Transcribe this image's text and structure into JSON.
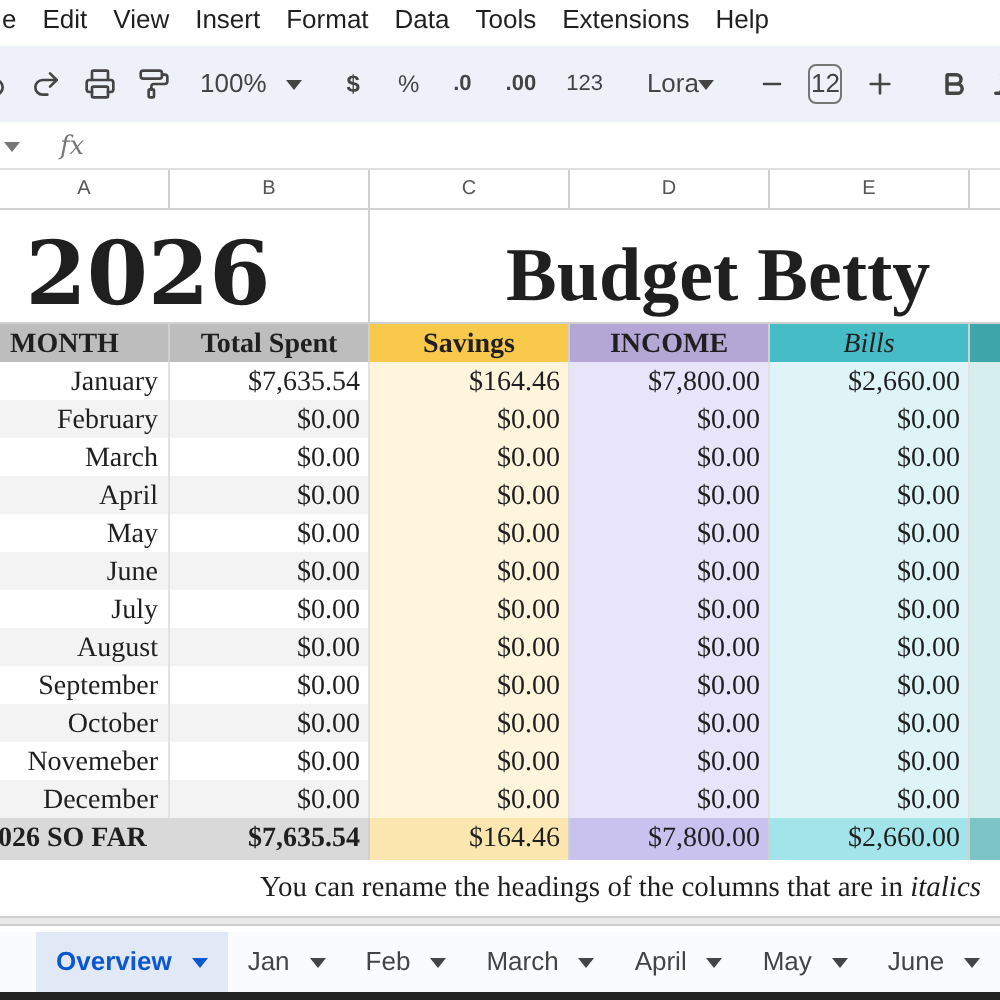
{
  "menu": [
    "e",
    "Edit",
    "View",
    "Insert",
    "Format",
    "Data",
    "Tools",
    "Extensions",
    "Help"
  ],
  "toolbar": {
    "zoom": "100%",
    "currency": "$",
    "percent": "%",
    "dec_less": ".0",
    "dec_more": ".00",
    "number_format": "123",
    "font": "Lora",
    "font_size": "12"
  },
  "formula_bar": {
    "fx": "fx"
  },
  "columns": [
    "A",
    "B",
    "C",
    "D",
    "E"
  ],
  "title": {
    "year": "2026",
    "name": "Budget Betty"
  },
  "headers": [
    {
      "label": "MONTH",
      "italic": false
    },
    {
      "label": "Total Spent",
      "italic": false
    },
    {
      "label": "Savings",
      "italic": false
    },
    {
      "label": "INCOME",
      "italic": false
    },
    {
      "label": "Bills",
      "italic": true
    }
  ],
  "rows": [
    {
      "month": "January",
      "values": [
        "$7,635.54",
        "$164.46",
        "$7,800.00",
        "$2,660.00"
      ]
    },
    {
      "month": "February",
      "values": [
        "$0.00",
        "$0.00",
        "$0.00",
        "$0.00"
      ]
    },
    {
      "month": "March",
      "values": [
        "$0.00",
        "$0.00",
        "$0.00",
        "$0.00"
      ]
    },
    {
      "month": "April",
      "values": [
        "$0.00",
        "$0.00",
        "$0.00",
        "$0.00"
      ]
    },
    {
      "month": "May",
      "values": [
        "$0.00",
        "$0.00",
        "$0.00",
        "$0.00"
      ]
    },
    {
      "month": "June",
      "values": [
        "$0.00",
        "$0.00",
        "$0.00",
        "$0.00"
      ]
    },
    {
      "month": "July",
      "values": [
        "$0.00",
        "$0.00",
        "$0.00",
        "$0.00"
      ]
    },
    {
      "month": "August",
      "values": [
        "$0.00",
        "$0.00",
        "$0.00",
        "$0.00"
      ]
    },
    {
      "month": "September",
      "values": [
        "$0.00",
        "$0.00",
        "$0.00",
        "$0.00"
      ]
    },
    {
      "month": "October",
      "values": [
        "$0.00",
        "$0.00",
        "$0.00",
        "$0.00"
      ]
    },
    {
      "month": "Novemeber",
      "values": [
        "$0.00",
        "$0.00",
        "$0.00",
        "$0.00"
      ]
    },
    {
      "month": "December",
      "values": [
        "$0.00",
        "$0.00",
        "$0.00",
        "$0.00"
      ]
    }
  ],
  "total": {
    "label": "026 SO FAR",
    "values": [
      "$7,635.54",
      "$164.46",
      "$7,800.00",
      "$2,660.00"
    ]
  },
  "note": "You can rename the headings of the columns that are in *italics*",
  "sheet_tabs": [
    {
      "label": "Overview",
      "selected": true
    },
    {
      "label": "Jan",
      "selected": false
    },
    {
      "label": "Feb",
      "selected": false
    },
    {
      "label": "March",
      "selected": false
    },
    {
      "label": "April",
      "selected": false
    },
    {
      "label": "May",
      "selected": false
    },
    {
      "label": "June",
      "selected": false
    }
  ]
}
